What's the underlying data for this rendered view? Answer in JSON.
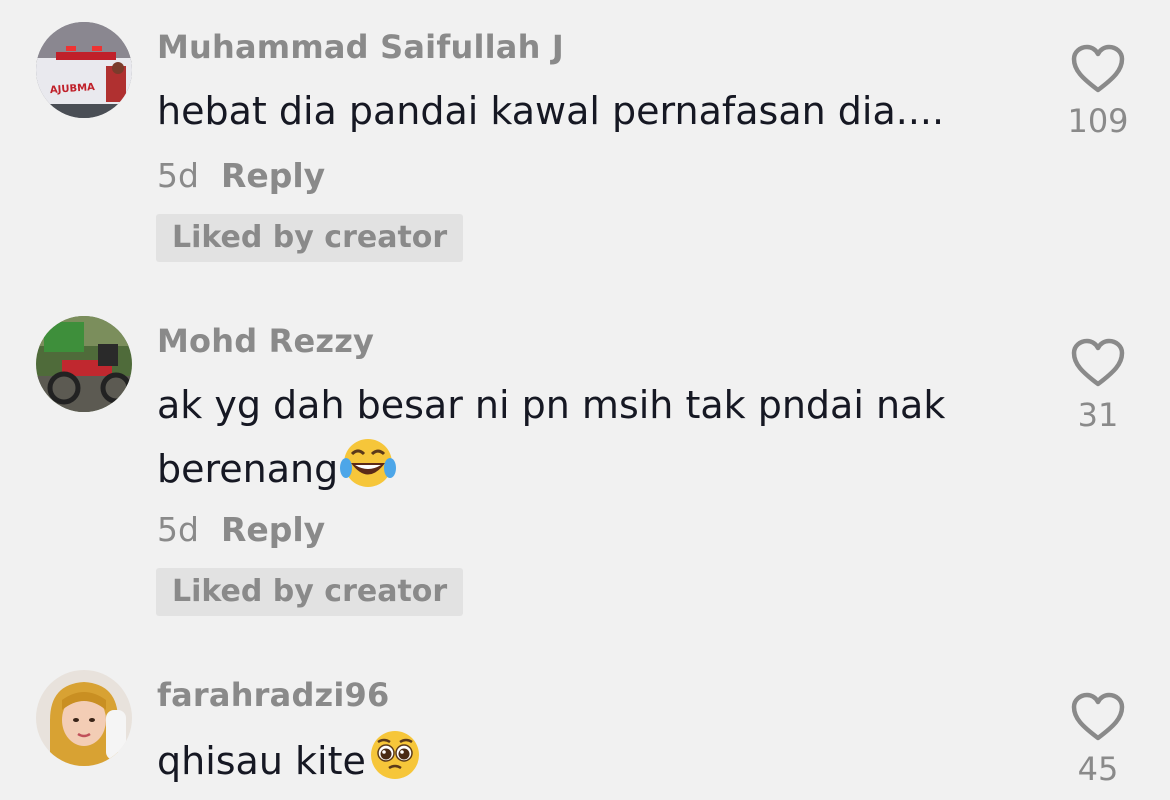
{
  "comments": [
    {
      "username": "Muhammad Saifullah J",
      "avatar": "ambulance-photo",
      "text_line1": "hebat dia pandai kawal pernafasan dia....",
      "text_line2": "",
      "emoji": "",
      "time": "5d",
      "reply_label": "Reply",
      "liked_label": "Liked by creator",
      "likes": "109"
    },
    {
      "username": "Mohd Rezzy",
      "avatar": "motorcycle-photo",
      "text_line1": "ak yg dah besar ni pn msih tak pndai nak",
      "text_line2": "berenang",
      "emoji": "tears-of-joy",
      "time": "5d",
      "reply_label": "Reply",
      "liked_label": "Liked by creator",
      "likes": "31"
    },
    {
      "username": "farahradzi96",
      "avatar": "hijab-woman-photo",
      "text_line1": "qhisau kite",
      "text_line2": "",
      "emoji": "pleading-face",
      "time": "",
      "reply_label": "",
      "liked_label": "",
      "likes": "45"
    }
  ],
  "colors": {
    "background": "#f1f1f1",
    "text": "#161823",
    "muted": "#8a8a8a",
    "badge_bg": "#e2e2e2"
  },
  "icons": {
    "like": "heart-outline-icon"
  }
}
